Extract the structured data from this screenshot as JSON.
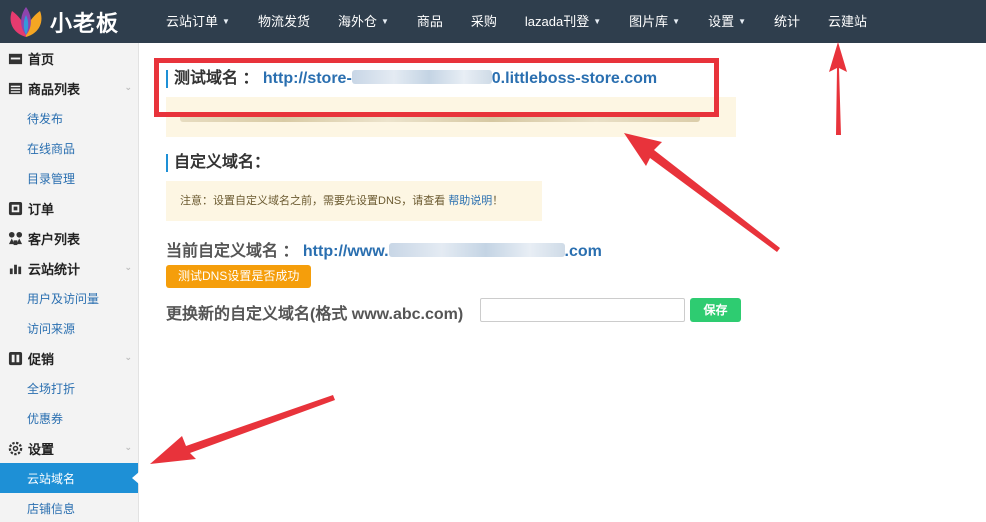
{
  "app": {
    "logo_text": "小老板"
  },
  "nav": [
    {
      "label": "云站订单",
      "caret": true
    },
    {
      "label": "物流发货",
      "caret": false
    },
    {
      "label": "海外仓",
      "caret": true
    },
    {
      "label": "商品",
      "caret": false
    },
    {
      "label": "采购",
      "caret": false
    },
    {
      "label": "lazada刊登",
      "caret": true
    },
    {
      "label": "图片库",
      "caret": true
    },
    {
      "label": "设置",
      "caret": true
    },
    {
      "label": "统计",
      "caret": false
    },
    {
      "label": "云建站",
      "caret": false
    }
  ],
  "sidebar": [
    {
      "label": "首页",
      "type": "head",
      "icon": "home-icon"
    },
    {
      "label": "商品列表",
      "type": "head",
      "icon": "list-icon",
      "chevron": true
    },
    {
      "label": "待发布",
      "type": "sub"
    },
    {
      "label": "在线商品",
      "type": "sub"
    },
    {
      "label": "目录管理",
      "type": "sub"
    },
    {
      "label": "订单",
      "type": "head",
      "icon": "order-icon"
    },
    {
      "label": "客户列表",
      "type": "head",
      "icon": "customers-icon"
    },
    {
      "label": "云站统计",
      "type": "head",
      "icon": "chart-icon",
      "chevron": true
    },
    {
      "label": "用户及访问量",
      "type": "sub"
    },
    {
      "label": "访问来源",
      "type": "sub"
    },
    {
      "label": "促销",
      "type": "head",
      "icon": "promo-icon",
      "chevron": true
    },
    {
      "label": "全场打折",
      "type": "sub"
    },
    {
      "label": "优惠券",
      "type": "sub"
    },
    {
      "label": "设置",
      "type": "head",
      "icon": "gear-icon",
      "chevron": true
    },
    {
      "label": "云站域名",
      "type": "sub",
      "active": true
    },
    {
      "label": "店铺信息",
      "type": "sub"
    }
  ],
  "main": {
    "test_domain": {
      "label": "测试域名 ：",
      "url_prefix": "http://store-",
      "url_suffix": "0.littleboss-store.com"
    },
    "custom_domain": {
      "title": "自定义域名：",
      "note_prefix": "注意：设置自定义域名之前，需要先设置DNS，请查看 ",
      "note_link": "帮助说明",
      "note_suffix": "！"
    },
    "current_domain": {
      "label": "当前自定义域名 ：",
      "url_prefix": "http://www.",
      "url_suffix": ".com",
      "test_button": "测试DNS设置是否成功"
    },
    "replace_domain": {
      "label": "更换新的自定义域名(格式 www.abc.com)",
      "input_value": "",
      "save_button": "保存"
    }
  },
  "colors": {
    "topbar": "#2f3e4d",
    "accent": "#1e90d6",
    "link": "#2a6fb0",
    "orange": "#f59e0b",
    "green": "#2ecc71",
    "annotation": "#e8333b"
  }
}
